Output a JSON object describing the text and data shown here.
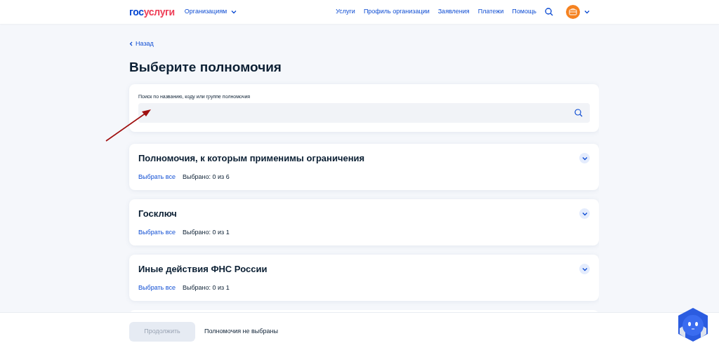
{
  "header": {
    "logo": {
      "first": "гос",
      "second": "услуги"
    },
    "org_menu": "Организациям",
    "nav": [
      "Услуги",
      "Профиль организации",
      "Заявления",
      "Платежи",
      "Помощь"
    ]
  },
  "back": "Назад",
  "title": "Выберите полномочия",
  "search": {
    "label": "Поиск по названию, коду или группе полномочия"
  },
  "groups": [
    {
      "title": "Полномочия, к которым применимы ограничения",
      "select_all": "Выбрать все",
      "count": "Выбрано: 0 из 6"
    },
    {
      "title": "Госключ",
      "select_all": "Выбрать все",
      "count": "Выбрано: 0 из 1"
    },
    {
      "title": "Иные действия ФНС России",
      "select_all": "Выбрать все",
      "count": "Выбрано: 0 из 1"
    }
  ],
  "footer": {
    "button": {
      "label": "Продолжить",
      "disabled": true
    },
    "status": "Полномочия не выбраны"
  }
}
